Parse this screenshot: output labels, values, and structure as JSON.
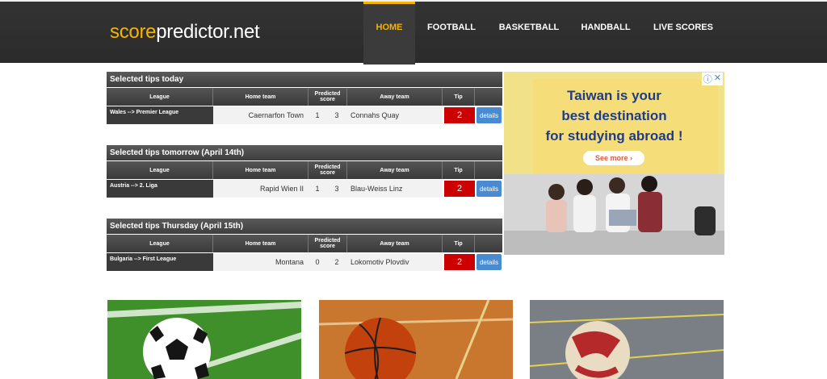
{
  "logo": {
    "part1": "score",
    "part2": "predictor.net"
  },
  "nav": [
    {
      "label": "HOME",
      "active": true
    },
    {
      "label": "FOOTBALL",
      "active": false
    },
    {
      "label": "BASKETBALL",
      "active": false
    },
    {
      "label": "HANDBALL",
      "active": false
    },
    {
      "label": "LIVE SCORES",
      "active": false
    }
  ],
  "columns": {
    "league": "League",
    "home": "Home team",
    "predicted": "Predicted score",
    "away": "Away team",
    "tip": "Tip"
  },
  "sections": [
    {
      "title": "Selected tips today",
      "league": "Wales --> Premier League",
      "home": "Caernarfon Town",
      "score_home": "1",
      "score_away": "3",
      "away": "Connahs Quay",
      "tip": "2",
      "details": "details"
    },
    {
      "title": "Selected tips tomorrow (April 14th)",
      "league": "Austria --> 2. Liga",
      "home": "Rapid Wien II",
      "score_home": "1",
      "score_away": "3",
      "away": "Blau-Weiss Linz",
      "tip": "2",
      "details": "details"
    },
    {
      "title": "Selected tips Thursday (April 15th)",
      "league": "Bulgaria --> First League",
      "home": "Montana",
      "score_home": "0",
      "score_away": "2",
      "away": "Lokomotiv Plovdiv",
      "tip": "2",
      "details": "details"
    }
  ],
  "ad": {
    "line1": "Taiwan is your",
    "line2": "best destination",
    "line3": "for studying abroad !",
    "button": "See more ›",
    "info_icon": "ⓘ",
    "close_icon": "✕"
  },
  "cards": [
    {
      "sport": "football"
    },
    {
      "sport": "basketball"
    },
    {
      "sport": "handball"
    }
  ]
}
